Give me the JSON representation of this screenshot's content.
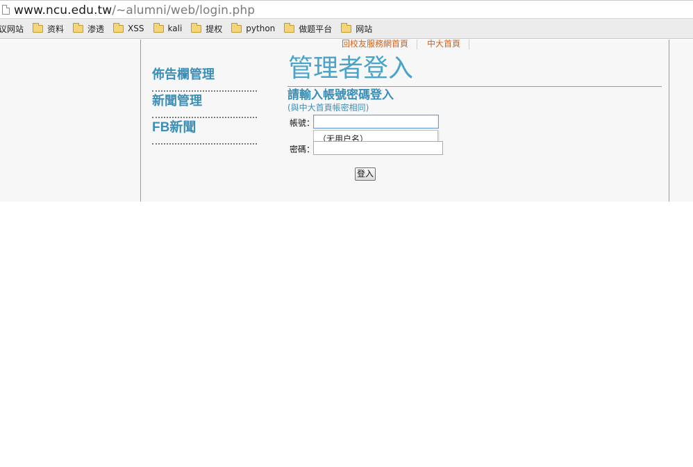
{
  "browser": {
    "url_host": "www.ncu.edu.tw",
    "url_path": "/~alumni/web/login.php",
    "bookmarks": [
      {
        "label": "议网站",
        "icon": "none"
      },
      {
        "label": "资料",
        "icon": "folder-icon"
      },
      {
        "label": "渗透",
        "icon": "folder-icon"
      },
      {
        "label": "XSS",
        "icon": "folder-icon"
      },
      {
        "label": "kali",
        "icon": "folder-icon"
      },
      {
        "label": "提权",
        "icon": "folder-icon"
      },
      {
        "label": "python",
        "icon": "folder-icon"
      },
      {
        "label": "做题平台",
        "icon": "folder-icon"
      },
      {
        "label": "网站",
        "icon": "folder-icon"
      }
    ]
  },
  "header": {
    "links": [
      "回校友服務網首頁",
      "中大首頁"
    ]
  },
  "sidebar": {
    "items": [
      {
        "label": "佈告欄管理"
      },
      {
        "label": "新聞管理"
      },
      {
        "label": "FB新聞"
      }
    ]
  },
  "login": {
    "title": "管理者登入",
    "subtitle": "請輸入帳號密碼登入",
    "note": "(與中大首頁帳密相同)",
    "account_label": "帳號：",
    "account_value": "",
    "password_label": "密碼：",
    "password_value": "",
    "autocomplete_text": "（无用户名）",
    "submit_label": "登入"
  },
  "colors": {
    "accent_blue": "#3b8fb7",
    "link_orange": "#d0621b"
  }
}
